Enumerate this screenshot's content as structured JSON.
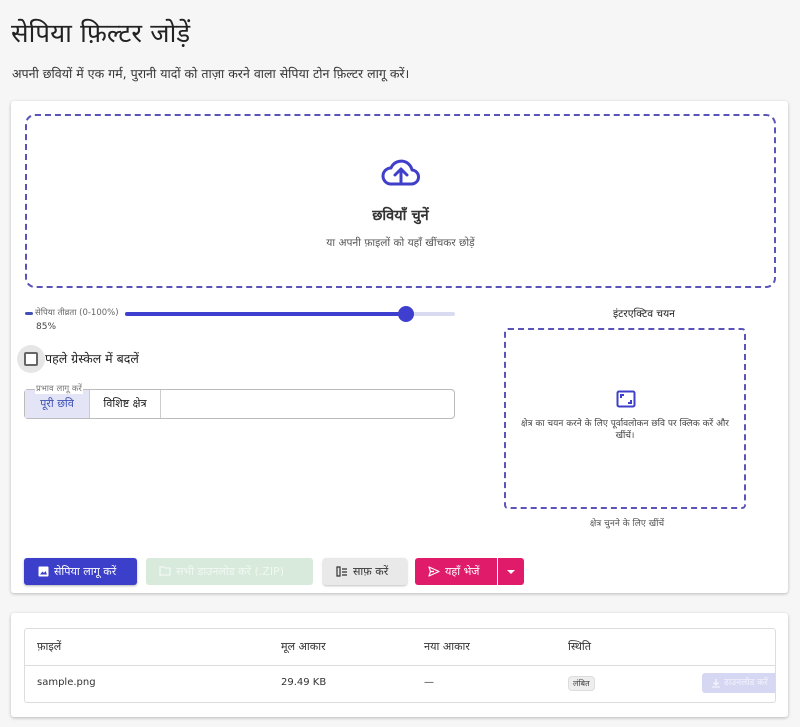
{
  "header": {
    "title": "सेपिया फ़िल्टर जोड़ें",
    "description": "अपनी छवियों में एक गर्म, पुरानी यादों को ताज़ा करने वाला सेपिया टोन फ़िल्टर लागू करें।"
  },
  "dropzone": {
    "icon": "cloud-upload-icon",
    "title": "छवियाँ चुनें",
    "subtitle": "या अपनी फ़ाइलों को यहाँ खींचकर छोड़ें"
  },
  "controls": {
    "intensity_label": "सेपिया तीव्रता (0-100%)",
    "intensity_value": 85,
    "intensity_value_text": "85%",
    "grayscale_label": "पहले ग्रेस्केल में बदलें",
    "grayscale_checked": false,
    "apply_legend": "प्रभाव लागू करें",
    "apply_options": [
      {
        "label": "पूरी छवि",
        "active": true
      },
      {
        "label": "विशिष्ट क्षेत्र",
        "active": false
      }
    ]
  },
  "interactive": {
    "title": "इंटरएक्टिव चयन",
    "icon": "select-area-icon",
    "hint": "क्षेत्र का चयन करने के लिए पूर्वावलोकन छवि पर क्लिक करें और खींचें।",
    "caption": "क्षेत्र चुनने के लिए खींचें"
  },
  "actions": {
    "apply_label": "सेपिया लागू करें",
    "download_all_label": "सभी डाउनलोड करें (.ZIP)",
    "clear_label": "साफ़ करें",
    "send_label": "यहाँ भेजें"
  },
  "files": {
    "headers": [
      "फ़ाइलें",
      "मूल आकार",
      "नया आकार",
      "स्थिति"
    ],
    "rows": [
      {
        "name": "sample.png",
        "original_size": "29.49 KB",
        "new_size": "—",
        "status": "लंबित",
        "download_label": "डाउनलोड करें"
      }
    ]
  },
  "colors": {
    "primary": "#3b3fc9",
    "accent": "#e01b6a",
    "success_disabled": "#d7eadb",
    "dashed_border": "#5b54b8"
  }
}
